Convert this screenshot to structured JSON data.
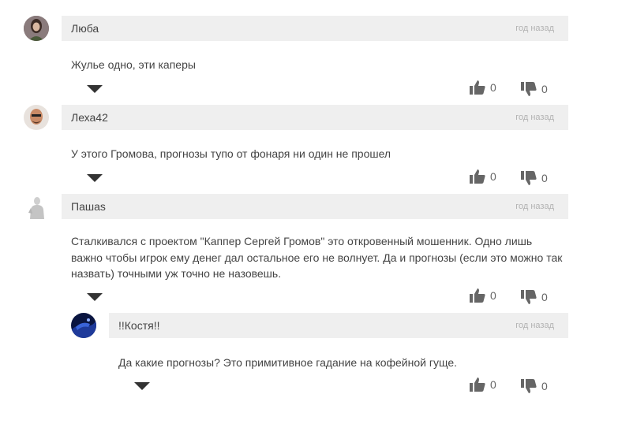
{
  "comments": [
    {
      "author": "Люба",
      "time": "год назад",
      "text": "Жулье одно, эти каперы",
      "likes": "0",
      "dislikes": "0"
    },
    {
      "author": "Леха42",
      "time": "год назад",
      "text": "У этого Громова, прогнозы тупо от фонаря ни один не прошел",
      "likes": "0",
      "dislikes": "0"
    },
    {
      "author": "Пашаs",
      "time": "год назад",
      "text": "Сталкивался с проектом \"Каппер Сергей Громов\" это откровенный мошенник. Одно лишь важно чтобы игрок ему денег дал остальное его не волнует. Да и прогнозы (если это можно так назвать) точными уж точно не назовешь.",
      "likes": "0",
      "dislikes": "0"
    },
    {
      "author": "!!Костя!!",
      "time": "год назад",
      "text": "Да какие прогнозы? Это примитивное гадание на кофейной гуще.",
      "likes": "0",
      "dislikes": "0"
    }
  ],
  "icons": {
    "like": "thumbs-up-icon",
    "dislike": "thumbs-down-icon",
    "reply": "triangle-down-icon"
  },
  "colors": {
    "header_bg": "#efefef",
    "text": "#444444",
    "time": "#b3b3b3",
    "icon": "#666666"
  }
}
